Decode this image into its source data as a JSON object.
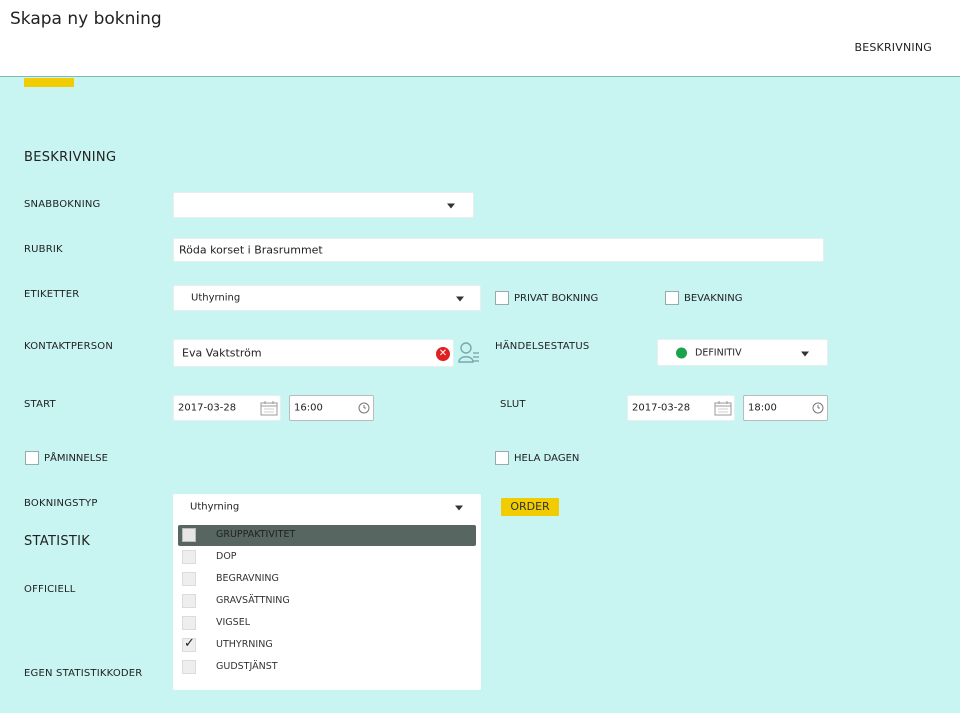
{
  "header": {
    "title": "Skapa ny bokning",
    "tab_label": "BESKRIVNING"
  },
  "form": {
    "section_title": "BESKRIVNING",
    "snabbbokning": {
      "label": "SNABBOKNING",
      "value": ""
    },
    "rubrik": {
      "label": "RUBRIK",
      "value": "Röda korset i Brasrummet"
    },
    "etiketter": {
      "label": "ETIKETTER",
      "value": "Uthyrning"
    },
    "privat_bokning": {
      "label": "PRIVAT BOKNING",
      "checked": false
    },
    "bevakning": {
      "label": "BEVAKNING",
      "checked": false
    },
    "kontaktperson": {
      "label": "KONTAKTPERSON",
      "value": "Eva Vaktström"
    },
    "handelsestatus": {
      "label": "HÄNDELSESTATUS",
      "value": "DEFINITIV",
      "color": "#1aa34a"
    },
    "start": {
      "label": "START",
      "date": "2017-03-28",
      "time": "16:00"
    },
    "slut": {
      "label": "SLUT",
      "date": "2017-03-28",
      "time": "18:00"
    },
    "paminnelse": {
      "label": "PÅMINNELSE",
      "checked": false
    },
    "hela_dagen": {
      "label": "HELA DAGEN",
      "checked": false
    },
    "bokningstyp": {
      "label": "BOKNINGSTYP",
      "value": "Uthyrning"
    },
    "order_button": "ORDER"
  },
  "statistik": {
    "section_title": "STATISTIK",
    "officiell_label": "OFFICIELL",
    "egen_label": "EGEN STATISTIKKODER"
  },
  "bokningstyp_options": [
    {
      "label": "GRUPPAKTIVITET",
      "checked": false,
      "highlighted": true
    },
    {
      "label": "DOP",
      "checked": false
    },
    {
      "label": "BEGRAVNING",
      "checked": false
    },
    {
      "label": "GRAVSÄTTNING",
      "checked": false
    },
    {
      "label": "VIGSEL",
      "checked": false
    },
    {
      "label": "UTHYRNING",
      "checked": true
    },
    {
      "label": "GUDSTJÄNST",
      "checked": false
    }
  ],
  "colors": {
    "background": "#c8f4f1",
    "accent": "#f0cc00",
    "clear": "#e02020"
  }
}
